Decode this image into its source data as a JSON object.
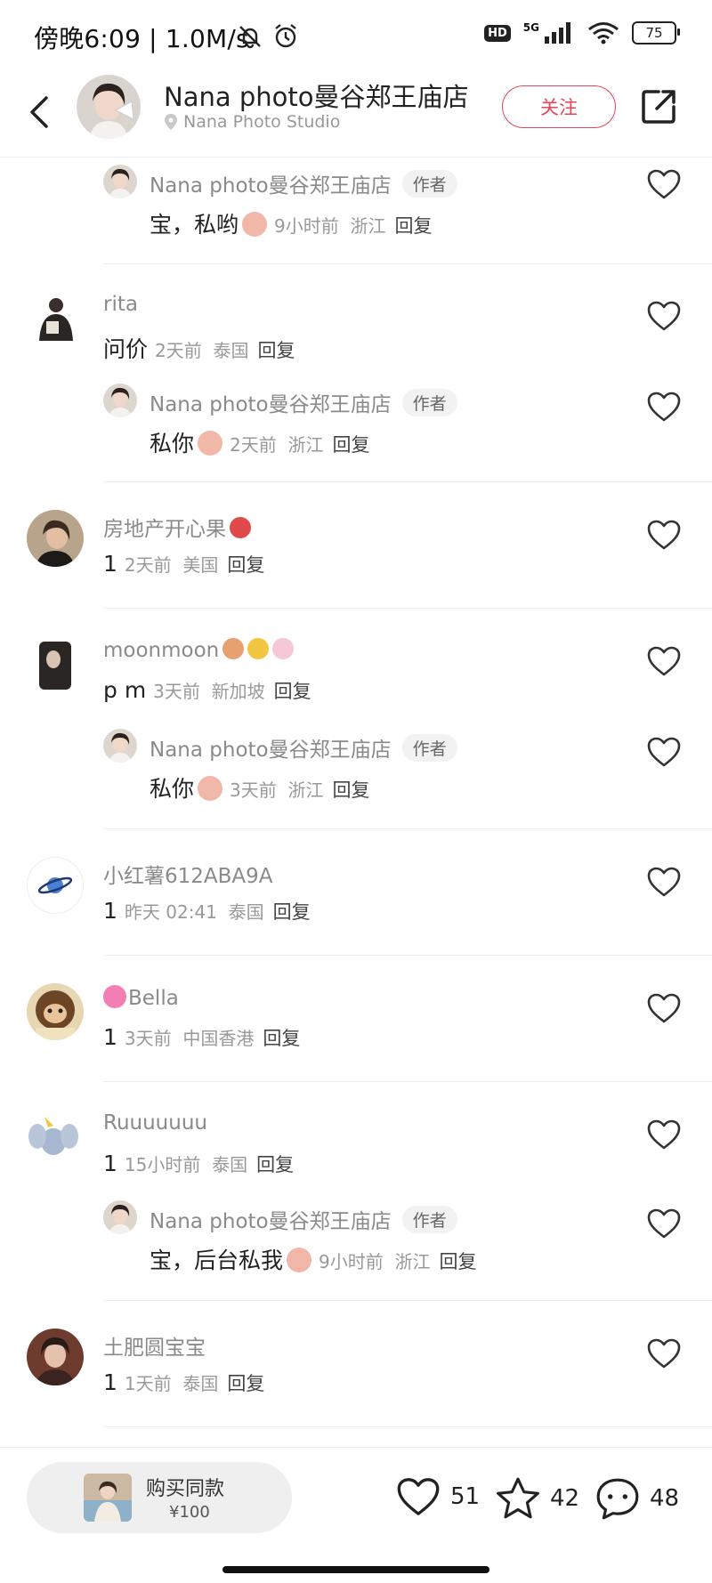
{
  "status": {
    "time": "傍晚6:09 | 1.0M/s",
    "hd": "HD",
    "net": "5G",
    "battery": "75"
  },
  "header": {
    "title": "Nana photo曼谷郑王庙店",
    "location": "Nana Photo Studio",
    "follow_label": "关注"
  },
  "author_tag": "作者",
  "reply_label": "回复",
  "comments": [
    {
      "name": "Nana photo曼谷郑王庙店",
      "text": "宝，私哟",
      "time": "9小时前",
      "region": "浙江"
    },
    {
      "name": "rita",
      "text": "问价",
      "time": "2天前",
      "region": "泰国"
    },
    {
      "name": "Nana photo曼谷郑王庙店",
      "text": "私你",
      "time": "2天前",
      "region": "浙江"
    },
    {
      "name": "房地产开心果",
      "text": "1",
      "time": "2天前",
      "region": "美国"
    },
    {
      "name": "moonmoon",
      "text": "p m",
      "time": "3天前",
      "region": "新加坡"
    },
    {
      "name": "Nana photo曼谷郑王庙店",
      "text": "私你",
      "time": "3天前",
      "region": "浙江"
    },
    {
      "name": "小红薯612ABA9A",
      "text": "1",
      "time": "昨天 02:41",
      "region": "泰国"
    },
    {
      "name": "Bella",
      "text": "1",
      "time": "3天前",
      "region": "中国香港"
    },
    {
      "name": "Ruuuuuuu",
      "text": "1",
      "time": "15小时前",
      "region": "泰国"
    },
    {
      "name": "Nana photo曼谷郑王庙店",
      "text": "宝，后台私我",
      "time": "9小时前",
      "region": "浙江"
    },
    {
      "name": "土肥圆宝宝",
      "text": "1",
      "time": "1天前",
      "region": "泰国"
    }
  ],
  "bottom": {
    "buy_title": "购买同款",
    "buy_price": "¥100",
    "likes": "51",
    "stars": "42",
    "comments": "48"
  },
  "colors": {
    "accent": "#e0475b",
    "muted_text": "#999999",
    "divider": "#ececec"
  }
}
